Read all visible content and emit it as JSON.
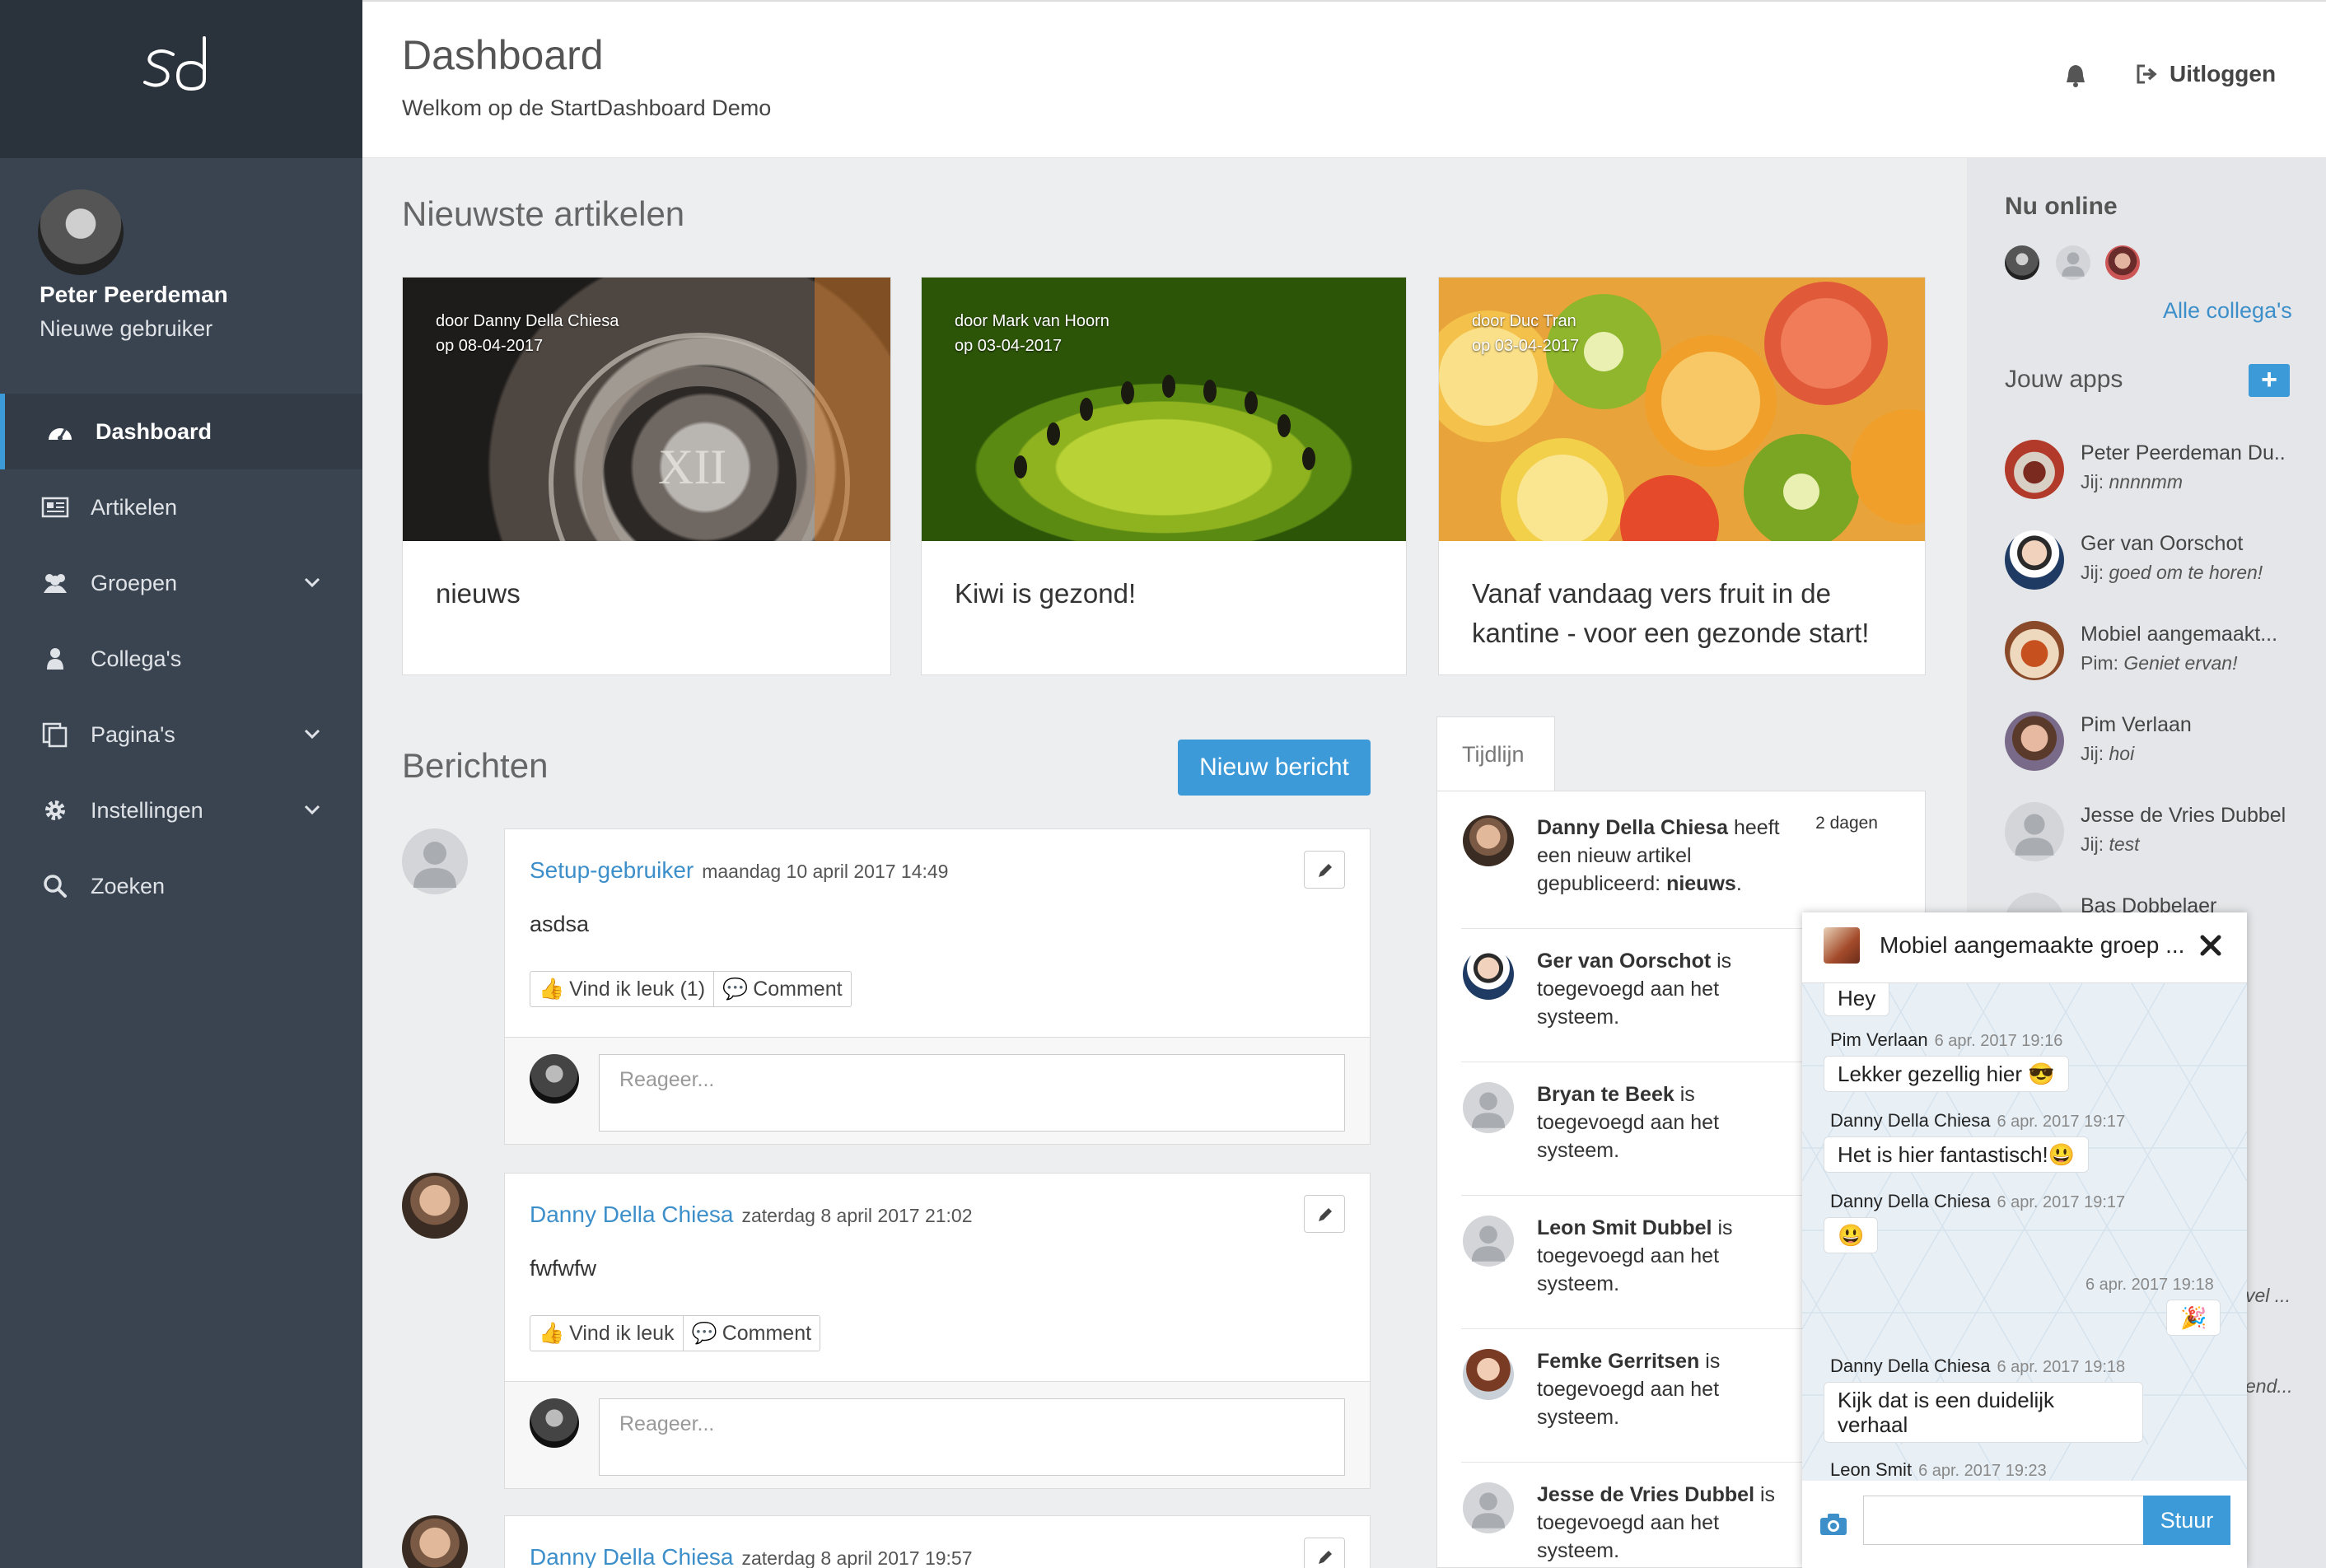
{
  "app": {
    "logo_text": "sd"
  },
  "header": {
    "title": "Dashboard",
    "subtitle": "Welkom op de StartDashboard Demo",
    "logout_label": "Uitloggen"
  },
  "user": {
    "name": "Peter Peerdeman",
    "role": "Nieuwe gebruiker"
  },
  "sidebar": {
    "items": [
      {
        "label": "Dashboard",
        "icon": "dashboard-icon",
        "active": true
      },
      {
        "label": "Artikelen",
        "icon": "newspaper-icon"
      },
      {
        "label": "Groepen",
        "icon": "users-icon",
        "expandable": true
      },
      {
        "label": "Collega's",
        "icon": "user-icon"
      },
      {
        "label": "Pagina's",
        "icon": "pages-icon",
        "expandable": true
      },
      {
        "label": "Instellingen",
        "icon": "gear-icon",
        "expandable": true
      },
      {
        "label": "Zoeken",
        "icon": "search-icon"
      }
    ]
  },
  "articles": {
    "title": "Nieuwste artikelen",
    "items": [
      {
        "author": "door Danny Della Chiesa",
        "date": "op 08-04-2017",
        "title": "nieuws"
      },
      {
        "author": "door Mark van Hoorn",
        "date": "op 03-04-2017",
        "title": "Kiwi is gezond!"
      },
      {
        "author": "door Duc Tran",
        "date": "op 03-04-2017",
        "title": "Vanaf vandaag vers fruit in de kantine - voor een gezonde start!"
      }
    ]
  },
  "posts": {
    "title": "Berichten",
    "new_button": "Nieuw bericht",
    "reply_placeholder": "Reageer...",
    "comment_label": "Comment",
    "items": [
      {
        "author": "Setup-gebruiker",
        "date": "maandag 10 april 2017 14:49",
        "body": "asdsa",
        "like_label": "Vind ik leuk (1)"
      },
      {
        "author": "Danny Della Chiesa",
        "date": "zaterdag 8 april 2017 21:02",
        "body": "fwfwfw",
        "like_label": "Vind ik leuk"
      },
      {
        "author": "Danny Della Chiesa",
        "date": "zaterdag 8 april 2017 19:57"
      }
    ]
  },
  "timeline": {
    "tab": "Tijdlijn",
    "items": [
      {
        "name": "Danny Della Chiesa",
        "pre": " heeft een nieuw artikel gepubliceerd: ",
        "object": "nieuws",
        "post": ".",
        "when": "2 dagen"
      },
      {
        "name": "Ger van Oorschot",
        "pre": " is toegevoegd aan het systeem."
      },
      {
        "name": "Bryan te Beek",
        "pre": " is toegevoegd aan het systeem."
      },
      {
        "name": "Leon Smit Dubbel",
        "pre": " is toegevoegd aan het systeem."
      },
      {
        "name": "Femke Gerritsen",
        "pre": " is toegevoegd aan het systeem."
      },
      {
        "name": "Jesse de Vries Dubbel",
        "pre": " is toegevoegd aan het systeem."
      }
    ]
  },
  "rail": {
    "online_title": "Nu online",
    "all_colleagues": "Alle collega's",
    "apps_title": "Jouw apps",
    "chats": [
      {
        "name": "Peter Peerdeman Du..",
        "prefix": "Jij: ",
        "msg": "nnnnmm"
      },
      {
        "name": "Ger van Oorschot",
        "prefix": "Jij: ",
        "msg": "goed om te horen!"
      },
      {
        "name": "Mobiel aangemaakt...",
        "prefix": "Pim: ",
        "msg": "Geniet ervan!"
      },
      {
        "name": "Pim Verlaan",
        "prefix": "Jij: ",
        "msg": "hoi"
      },
      {
        "name": "Jesse de Vries Dubbel",
        "prefix": "Jij: ",
        "msg": "test"
      },
      {
        "name": "Bas Dobbelaer",
        "prefix": "",
        "msg": ""
      }
    ],
    "peek_1": "vel ...",
    "peek_2": "end..."
  },
  "chat": {
    "title": "Mobiel aangemaakte groep ...",
    "messages": [
      {
        "text": "Hey"
      },
      {
        "author": "Pim Verlaan",
        "time": "6 apr. 2017 19:16",
        "text": "Lekker gezellig hier 😎"
      },
      {
        "author": "Danny Della Chiesa",
        "time": "6 apr. 2017 19:17",
        "text": "Het is hier fantastisch!😃"
      },
      {
        "author": "Danny Della Chiesa",
        "time": "6 apr. 2017 19:17",
        "text": "😃"
      },
      {
        "time": "6 apr. 2017 19:18",
        "text": "🎉"
      },
      {
        "author": "Danny Della Chiesa",
        "time": "6 apr. 2017 19:18",
        "text": "Kijk dat is een duidelijk verhaal"
      },
      {
        "author": "Leon Smit",
        "time": "6 apr. 2017 19:23"
      }
    ],
    "send_label": "Stuur"
  },
  "colors": {
    "accent": "#3d9ad9",
    "sidebar": "#3a4451",
    "sidebar_dark": "#2a333c"
  }
}
